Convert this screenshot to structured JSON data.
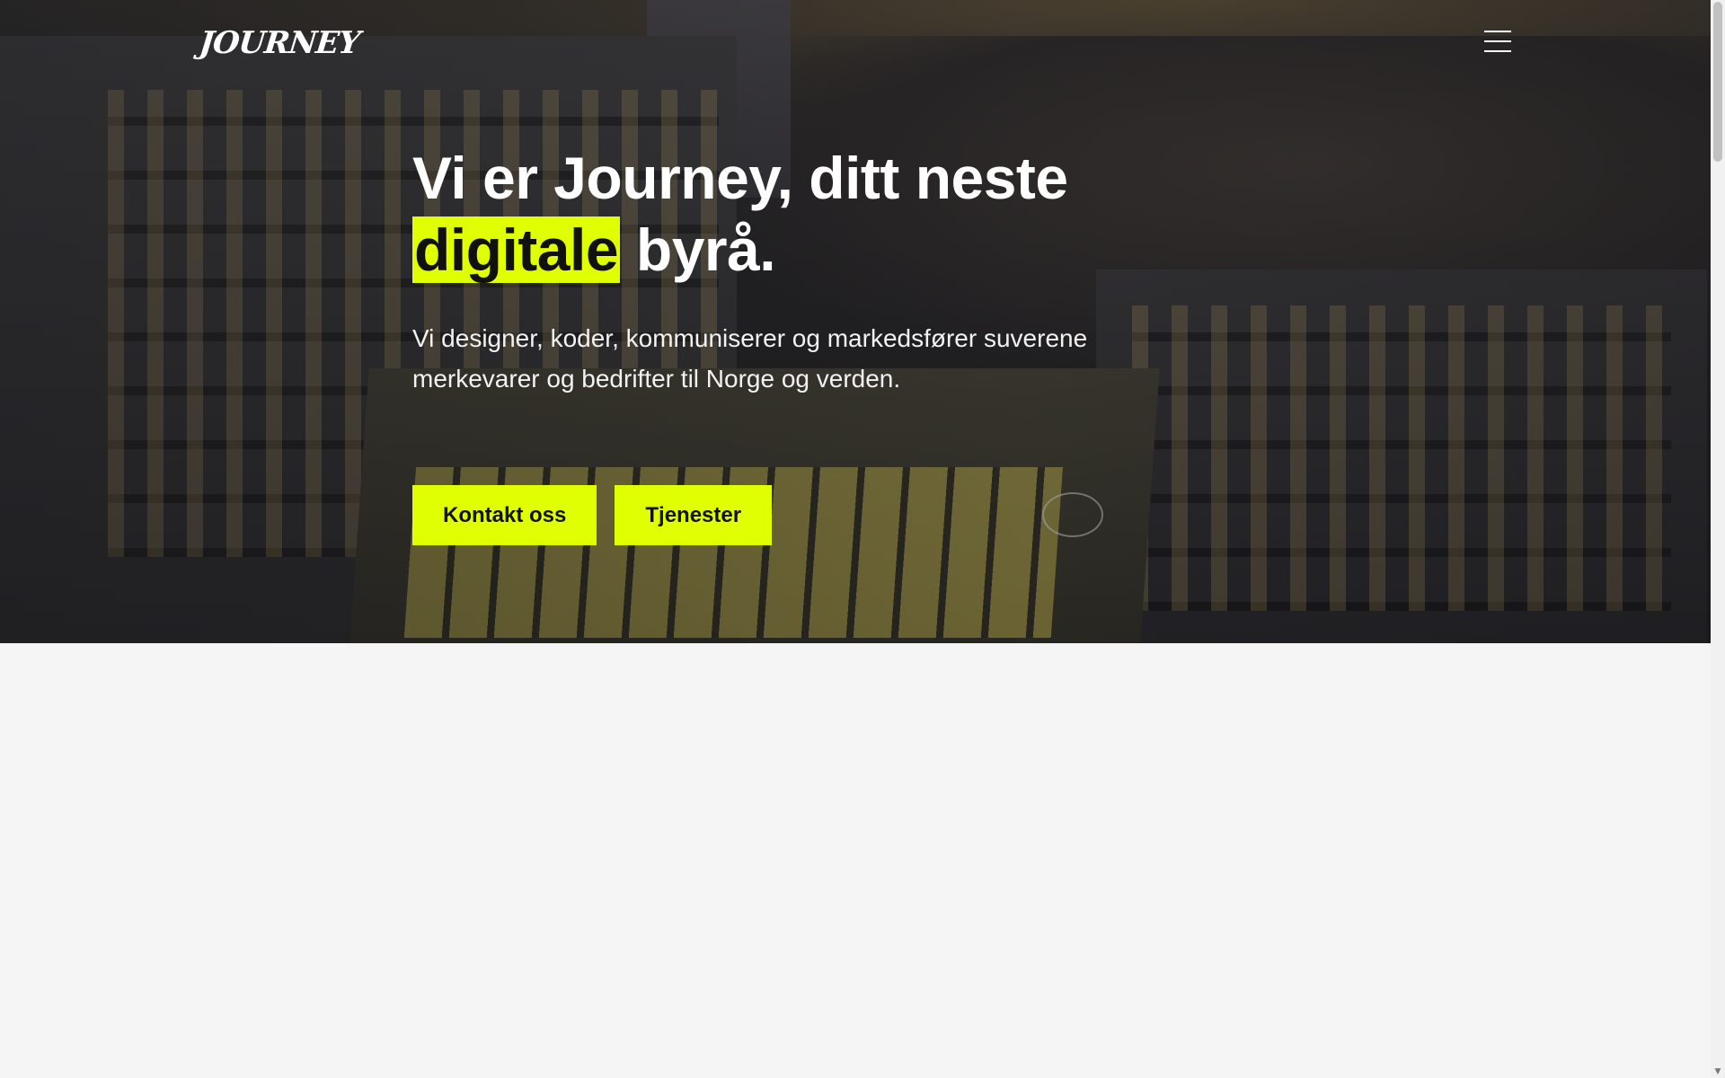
{
  "brand": {
    "logo_text": "JOURNEY"
  },
  "header": {
    "menu_icon": "hamburger-menu-icon"
  },
  "hero": {
    "title_before": "Vi er Journey, ditt neste",
    "title_highlight": "digitale",
    "title_after": "byrå.",
    "lead": "Vi designer, koder, kommuniserer og markedsfører suverene merkevarer og bedrifter til Norge og verden.",
    "buttons": {
      "contact": "Kontakt oss",
      "services": "Tjenester"
    }
  },
  "colors": {
    "accent": "#e0ff00",
    "hero_text": "#ffffff",
    "page_background": "#f5f5f5"
  },
  "scrollbar": {
    "up_arrow": "▲",
    "down_arrow": "▼"
  }
}
